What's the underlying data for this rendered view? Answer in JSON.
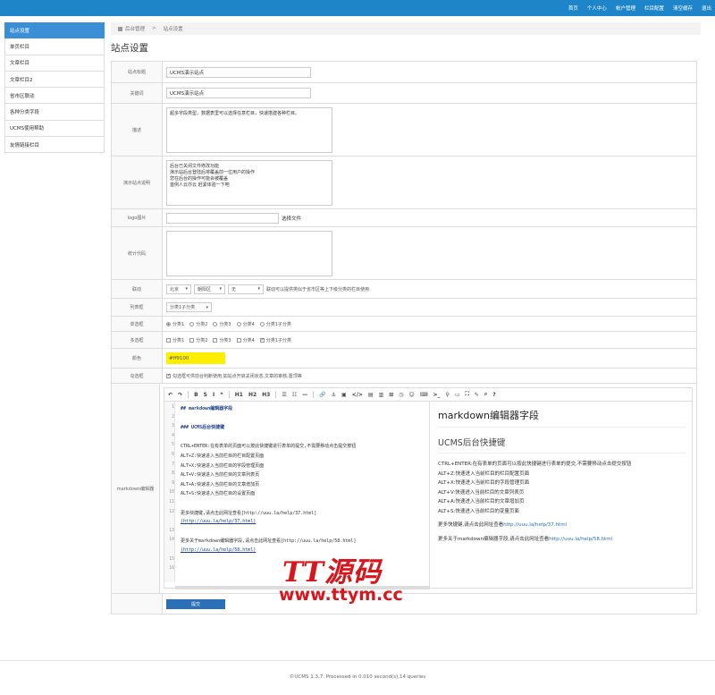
{
  "topnav": [
    "首页",
    "个人中心",
    "帐户管理",
    "栏目配置",
    "清空缓存",
    "退出"
  ],
  "sidebar": {
    "items": [
      "站点设置",
      "单页栏目",
      "文章栏目",
      "文章栏目2",
      "省市区联动",
      "各种分类字段",
      "UCMS使用帮助",
      "友情链接栏目"
    ]
  },
  "breadcrumb": {
    "home": "后台管理",
    "sep": ">",
    "current": "站点设置"
  },
  "page_title": "站点设置",
  "form": {
    "site_title": {
      "label": "站点标题",
      "value": "UCMS演示站点"
    },
    "keywords": {
      "label": "关键词",
      "value": "UCMS演示站点"
    },
    "description": {
      "label": "描述",
      "value": "超多字段类型，数据表里可以选择任意栏目，快速搭建各种栏目。"
    },
    "demo_note": {
      "label": "演示站点说明",
      "value": "后台已关闭文件修改功能\n演示站后台登陆后将覆盖前一位用户的操作\n您在后台的操作可能会被覆盖\n首例人云亦云 赶紧体验一下吧"
    },
    "logo": {
      "label": "logo图片",
      "button": "选择文件"
    },
    "stats_code": {
      "label": "统计代码",
      "value": ""
    },
    "linkage": {
      "label": "联动",
      "selects": [
        "北京",
        "朝阳区",
        "无"
      ],
      "hint": "联动可以提供类似于省市区等上下级分类的栏目使用"
    },
    "list": {
      "label": "列表框",
      "value": "分类1子分类"
    },
    "radio": {
      "label": "单选框",
      "options": [
        "分类1",
        "分类2",
        "分类3",
        "分类4",
        "分类1子分类"
      ],
      "selected": 0
    },
    "checkbox": {
      "label": "多选框",
      "options": [
        "分类1",
        "分类2",
        "分类3",
        "分类4",
        "分类1子分类"
      ],
      "checked": [
        4
      ]
    },
    "color": {
      "label": "颜色",
      "value": "#ff9100",
      "swatch": "#ffee00"
    },
    "tick": {
      "label": "勾选框",
      "text": "勾选框可供前台判断使用,如站点开启关闭状态,文章的审核,置顶等"
    },
    "markdown": {
      "label": "markdown编辑器"
    },
    "submit": "提交"
  },
  "editor": {
    "toolbar": [
      "↶",
      "↷",
      "B",
      "S",
      "I",
      "❝",
      "H1",
      "H2",
      "H3",
      "☰",
      "☷",
      "—",
      "🔗",
      "⚓",
      "▣",
      "</>",
      "▤",
      "▥",
      "⊞",
      "◷",
      "☺",
      "⌨",
      ">_",
      "⚲",
      "▭",
      "⛶",
      "✎",
      "⌕",
      "?"
    ],
    "lines": [
      {
        "n": "1",
        "t": "## markdown编辑器字段",
        "h": true
      },
      {
        "n": "2",
        "t": ""
      },
      {
        "n": "3",
        "t": "### UCMS后台快捷键",
        "h": true
      },
      {
        "n": "4",
        "t": ""
      },
      {
        "n": "5",
        "t": "CTRL+ENTER:在有表单的页面可以按此快捷键进行表单的提交,不需要移动点击提交按钮"
      },
      {
        "n": "6",
        "t": "ALT+Z:快速进入当前栏目的栏目配置页面"
      },
      {
        "n": "7",
        "t": "ALT+X:快速进入当前栏目的字段管理页面"
      },
      {
        "n": "8",
        "t": "ALT+V:快速进入当前栏目的文章列表页"
      },
      {
        "n": "9",
        "t": "ALT+A:快速进入当前栏目的文章增加页"
      },
      {
        "n": "10",
        "t": "ALT+S:快速进入当前栏目的设置页面"
      },
      {
        "n": "11",
        "t": ""
      },
      {
        "n": "12",
        "t": "更多快捷键,请点击此网址查看[http://uuu.la/help/37.html]"
      },
      {
        "n": "",
        "t": "(http://uuu.la/help/37.html)",
        "u": true
      },
      {
        "n": "13",
        "t": ""
      },
      {
        "n": "14",
        "t": "更多关于markdown编辑器字段,请点击此网址查看[http://uuu.la/help/58.html]"
      },
      {
        "n": "",
        "t": "(http://uuu.la/help/58.html)",
        "u": true
      },
      {
        "n": "15",
        "t": ""
      },
      {
        "n": "16",
        "t": ""
      }
    ],
    "preview": {
      "h1": "markdown编辑器字段",
      "h3": "UCMS后台快捷键",
      "p1": "CTRL+ENTER:在有表单的页面可以按此快捷键进行表单的提交,不需要移动点击提交按钮",
      "p2": "ALT+Z:快速进入当前栏目的栏目配置页面",
      "p3": "ALT+X:快速进入当前栏目的字段管理页面",
      "p4": "ALT+V:快速进入当前栏目的文章列表页",
      "p5": "ALT+A:快速进入当前栏目的文章增加页",
      "p6": "ALT+S:快速进入当前栏目的变量页面",
      "more1_text": "更多快捷键,请点击此网址查看",
      "more1_link": "http://uuu.la/help/37.html",
      "more2_text": "更多关于markdown编辑器字段,请点击此网址查看",
      "more2_link": "http://uuu.la/help/58.html"
    }
  },
  "footer": "©UCMS 1.3.7. Processed in 0.010 second(s),14 queries",
  "watermark": {
    "line1": "TT源码",
    "line2": "www.ttym.cc"
  }
}
